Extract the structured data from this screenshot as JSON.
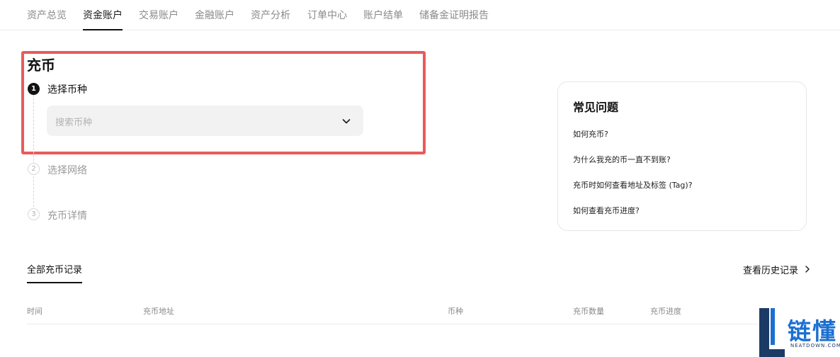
{
  "nav": {
    "tabs": [
      {
        "label": "资产总览",
        "active": false
      },
      {
        "label": "资金账户",
        "active": true
      },
      {
        "label": "交易账户",
        "active": false
      },
      {
        "label": "金融账户",
        "active": false
      },
      {
        "label": "资产分析",
        "active": false
      },
      {
        "label": "订单中心",
        "active": false
      },
      {
        "label": "账户结单",
        "active": false
      },
      {
        "label": "储备金证明报告",
        "active": false
      }
    ]
  },
  "deposit": {
    "title": "充币",
    "steps": [
      {
        "number": "1",
        "label": "选择币种",
        "state": "active"
      },
      {
        "number": "2",
        "label": "选择网络",
        "state": "inactive"
      },
      {
        "number": "3",
        "label": "充币详情",
        "state": "inactive"
      }
    ],
    "coin_select": {
      "placeholder": "搜索币种",
      "icon": "chevron-down-icon"
    }
  },
  "faq": {
    "title": "常见问题",
    "items": [
      "如何充币?",
      "为什么我充的币一直不到账?",
      "充币时如何查看地址及标签 (Tag)?",
      "如何查看充币进度?"
    ]
  },
  "records": {
    "tab_label": "全部充币记录",
    "history_link": "查看历史记录",
    "history_icon": "chevron-right-icon",
    "columns": [
      "时间",
      "充币地址",
      "币种",
      "充币数量",
      "充币进度"
    ]
  },
  "watermark": {
    "cn": "链懂",
    "en": "NEATDOWN.COM"
  },
  "colors": {
    "accent": "#121212",
    "highlight": "#e85b5b",
    "muted": "#8a8a8a",
    "watermark": "#1b6fd1"
  }
}
